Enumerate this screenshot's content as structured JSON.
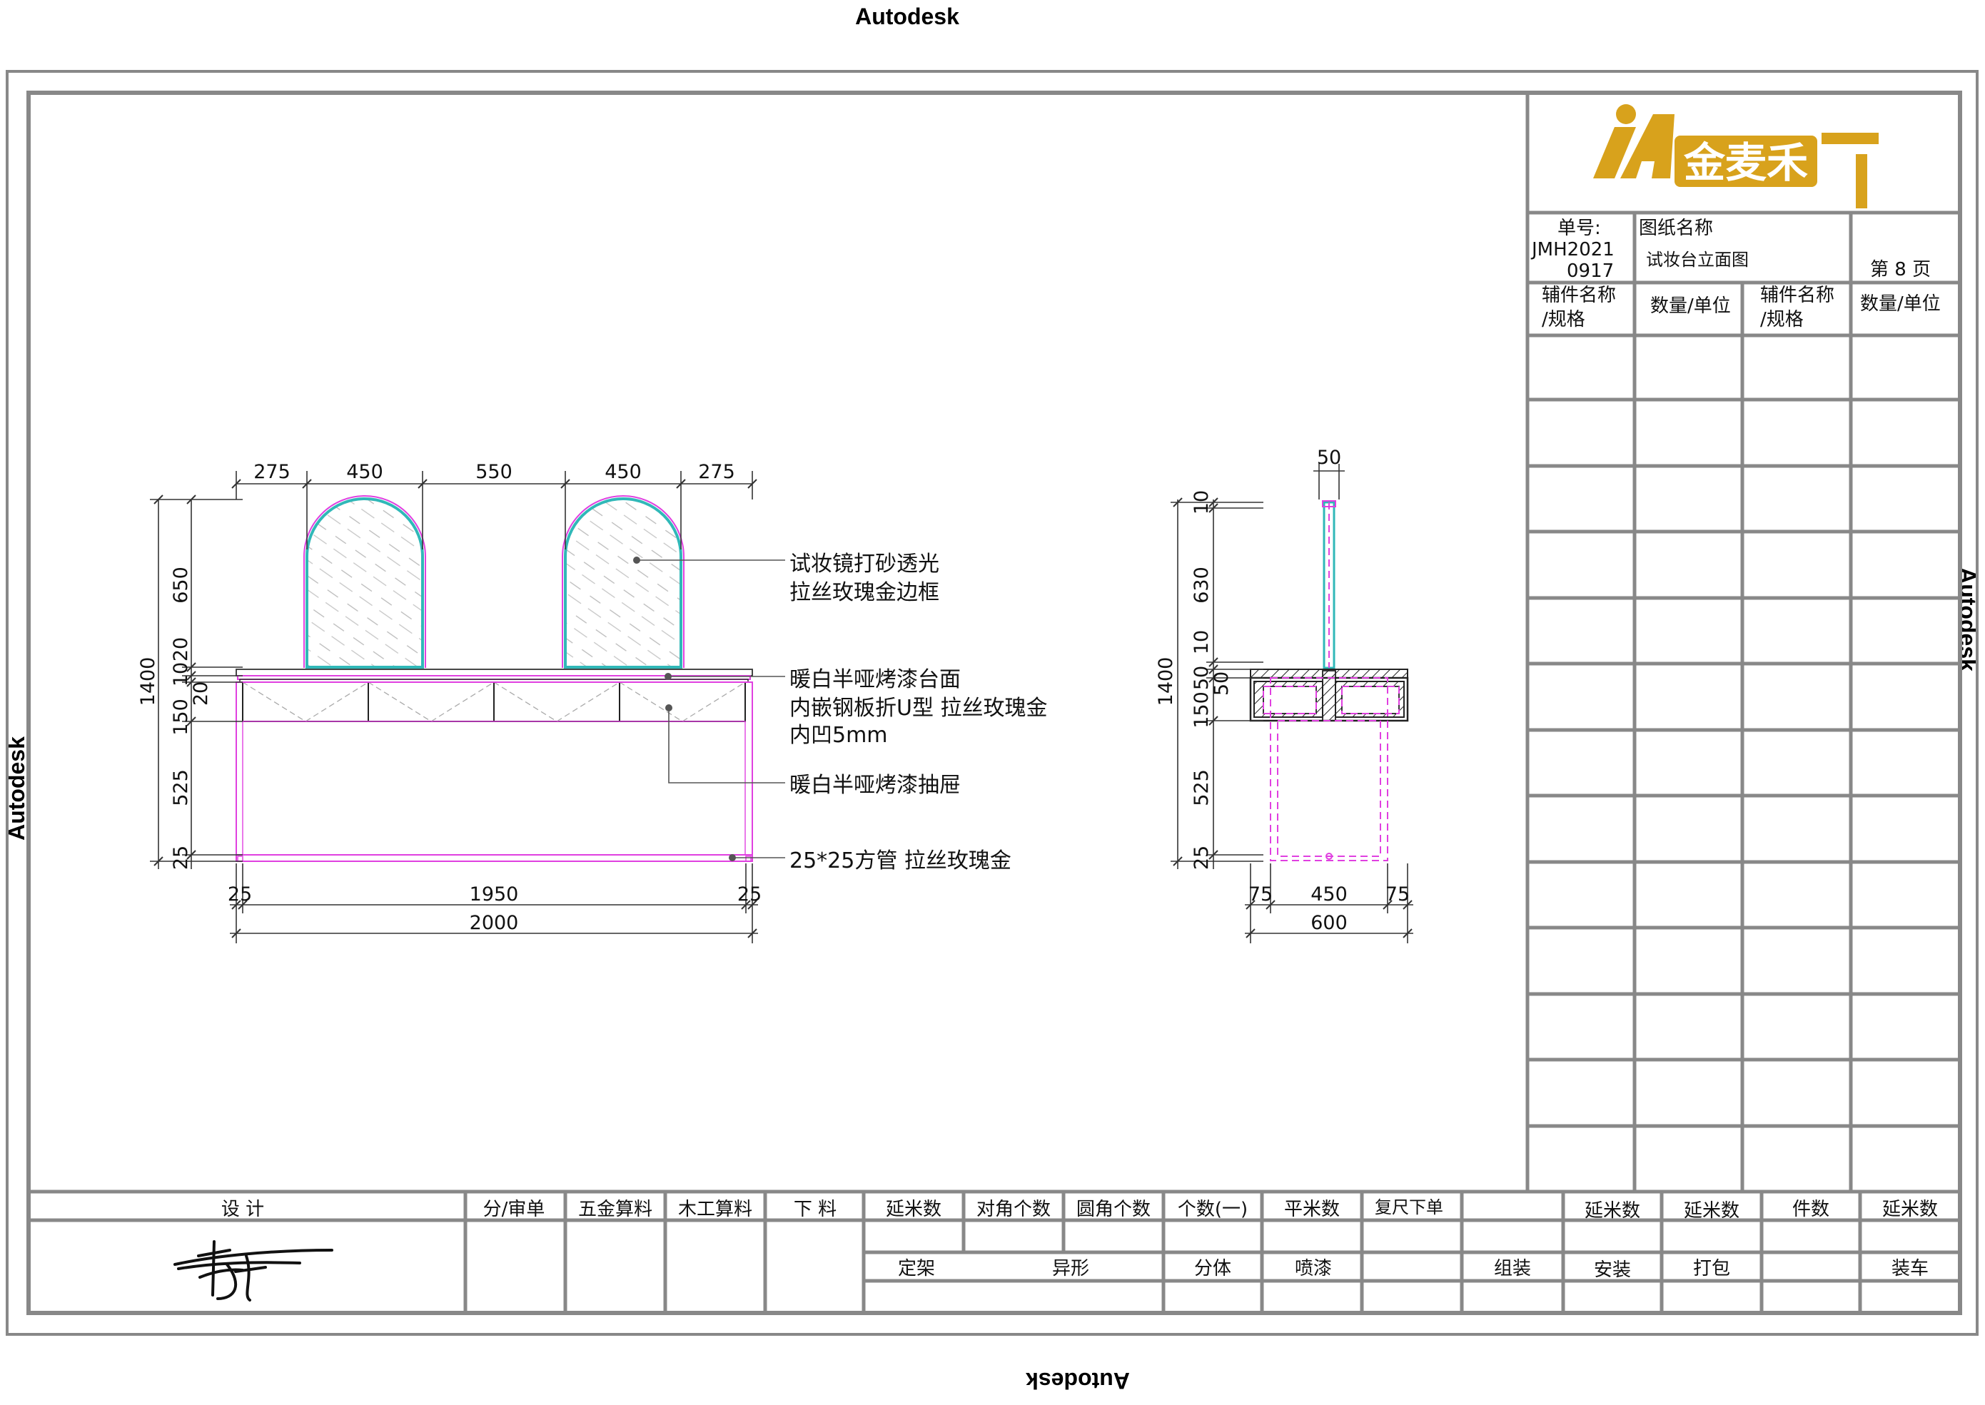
{
  "watermark": {
    "top": "Autodesk",
    "bottom": "Autodesk",
    "left": "Autodesk",
    "right": "Autodesk"
  },
  "front_view": {
    "top_dims": [
      "275",
      "450",
      "550",
      "450",
      "275"
    ],
    "left_dims": [
      "650",
      "20",
      "10",
      "20",
      "150",
      "525",
      "25"
    ],
    "overall_height": "1400",
    "bottom_dims": [
      "25",
      "1950",
      "25"
    ],
    "overall_width": "2000"
  },
  "side_view": {
    "top_dim": "50",
    "left_dims": [
      "10",
      "630",
      "10",
      "50",
      "50",
      "150",
      "525",
      "25"
    ],
    "overall_height": "1400",
    "bottom_dims": [
      "75",
      "450",
      "75"
    ],
    "overall_width": "600"
  },
  "callouts": {
    "mirror_line1": "试妆镜打砂透光",
    "mirror_line2": "拉丝玫瑰金边框",
    "top_line1": "暖白半哑烤漆台面",
    "top_line2": "内嵌钢板折U型 拉丝玫瑰金",
    "top_line3": "内凹5mm",
    "drawer": "暖白半哑烤漆抽屉",
    "tube": "25*25方管 拉丝玫瑰金"
  },
  "title_block": {
    "logo_text": "金麦禾",
    "order_label": "单号:",
    "order_number_line1": "JMH2021",
    "order_number_line2": "0917",
    "drawing_name_label": "图纸名称",
    "drawing_name": "试妆台立面图",
    "page_label": "第  8  页",
    "col_part_name_line1": "辅件名称",
    "col_part_name_line2": "/规格",
    "col_qty_unit": "数量/单位",
    "col_part_name2_line1": "辅件名称",
    "col_part_name2_line2": "/规格",
    "col_qty_unit2": "数量/单位"
  },
  "bottom_table": {
    "row1": [
      "设  计",
      "分/审单",
      "五金算料",
      "木工算料",
      "下    料",
      "延米数",
      "对角个数",
      "圆角个数",
      "个数(一)",
      "平米数",
      "复尺下单",
      "延米数",
      "延米数",
      "件数",
      "延米数"
    ],
    "row2": [
      "定架",
      "异形",
      "分体",
      "喷漆",
      "组装",
      "安装",
      "打包",
      "装车"
    ]
  },
  "colors": {
    "frame": "#888888",
    "magenta": "#e040e0",
    "cyan": "#30b8b8",
    "logo_gold": "#d8a21c"
  }
}
